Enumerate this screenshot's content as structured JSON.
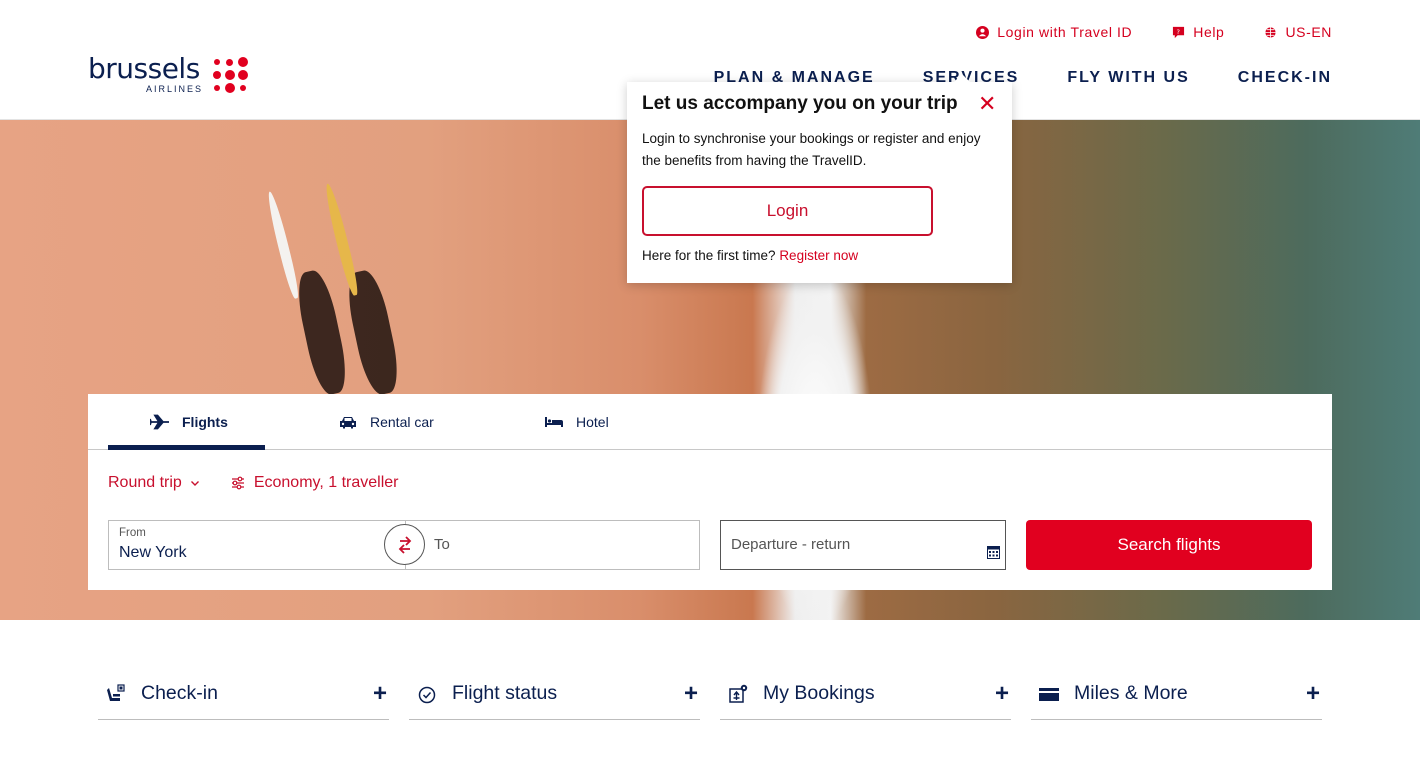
{
  "brand": {
    "name": "brussels",
    "subtitle": "AIRLINES",
    "primary_color": "#0b1f4f",
    "accent_color": "#e1001f"
  },
  "utility_nav": [
    {
      "icon": "user-circle-icon",
      "label": "Login with Travel ID"
    },
    {
      "icon": "help-chat-icon",
      "label": "Help"
    },
    {
      "icon": "globe-icon",
      "label": "US-EN"
    }
  ],
  "main_nav": [
    {
      "label": "PLAN & MANAGE"
    },
    {
      "label": "SERVICES"
    },
    {
      "label": "FLY WITH US"
    },
    {
      "label": "CHECK-IN"
    }
  ],
  "popup": {
    "title": "Let us accompany you on your trip",
    "close_icon": "close-icon",
    "text": "Login to synchronise your bookings or register and enjoy the benefits from having the TravelID.",
    "login_label": "Login",
    "first_time_text": "Here for the first time?",
    "register_label": "Register now"
  },
  "booking": {
    "tabs": [
      {
        "icon": "airplane-icon",
        "label": "Flights",
        "active": true
      },
      {
        "icon": "car-icon",
        "label": "Rental car",
        "active": false
      },
      {
        "icon": "bed-icon",
        "label": "Hotel",
        "active": false
      }
    ],
    "trip_type": "Round trip",
    "cabin_travellers": "Economy, 1 traveller",
    "from_label": "From",
    "from_value": "New York",
    "to_placeholder": "To",
    "dates_placeholder": "Departure - return",
    "search_label": "Search flights"
  },
  "quick_links": [
    {
      "icon": "seat-checkin-icon",
      "label": "Check-in"
    },
    {
      "icon": "clock-check-icon",
      "label": "Flight status"
    },
    {
      "icon": "booking-ticket-icon",
      "label": "My Bookings"
    },
    {
      "icon": "card-icon",
      "label": "Miles & More"
    }
  ]
}
